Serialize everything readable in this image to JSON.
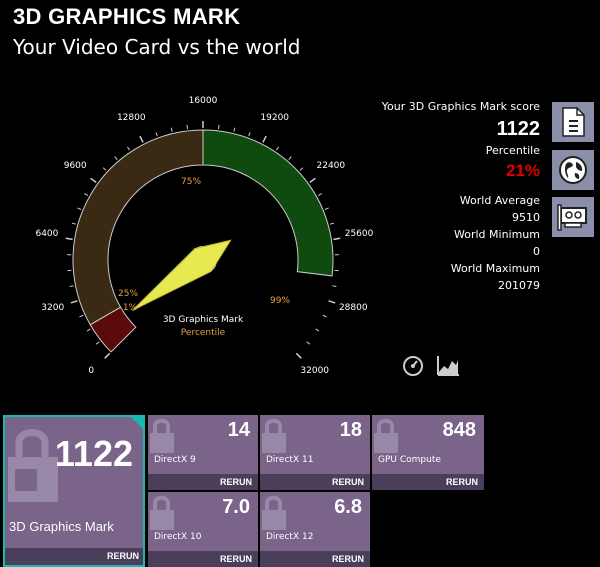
{
  "header": {
    "title": "3D GRAPHICS MARK",
    "subtitle": "Your Video Card vs the world"
  },
  "gauge": {
    "ticks": [
      "0",
      "3200",
      "6400",
      "9600",
      "12800",
      "16000",
      "19200",
      "22400",
      "25600",
      "28800",
      "32000"
    ],
    "max": 32000,
    "score": 1122,
    "percentile_markers": [
      "1%",
      "25%",
      "75%",
      "99%"
    ],
    "center_label": "3D Graphics Mark",
    "center_sublabel": "Percentile",
    "colors": {
      "low": "#5a0a0a",
      "mid": "#3a2a14",
      "high": "#0f4a0f",
      "needle": "#e8e850",
      "marker": "#e8a040"
    }
  },
  "score_panel": {
    "score_label": "Your 3D Graphics Mark score",
    "score": "1122",
    "percentile_label": "Percentile",
    "percentile": "21%",
    "world_average_label": "World Average",
    "world_average": "9510",
    "world_minimum_label": "World Minimum",
    "world_minimum": "0",
    "world_maximum_label": "World Maximum",
    "world_maximum": "201079"
  },
  "side_buttons": [
    {
      "icon": "document-icon"
    },
    {
      "icon": "globe-icon"
    },
    {
      "icon": "video-card-icon"
    }
  ],
  "bottom_icons": [
    {
      "icon": "speedometer-icon"
    },
    {
      "icon": "chart-icon"
    }
  ],
  "main_tile": {
    "value": "1122",
    "name": "3D Graphics Mark",
    "rerun": "RERUN"
  },
  "tiles": [
    {
      "value": "14",
      "name": "DirectX 9",
      "rerun": "RERUN"
    },
    {
      "value": "18",
      "name": "DirectX 11",
      "rerun": "RERUN"
    },
    {
      "value": "848",
      "name": "GPU Compute",
      "rerun": "RERUN"
    },
    {
      "value": "7.0",
      "name": "DirectX 10",
      "rerun": "RERUN"
    },
    {
      "value": "6.8",
      "name": "DirectX 12",
      "rerun": "RERUN"
    }
  ]
}
